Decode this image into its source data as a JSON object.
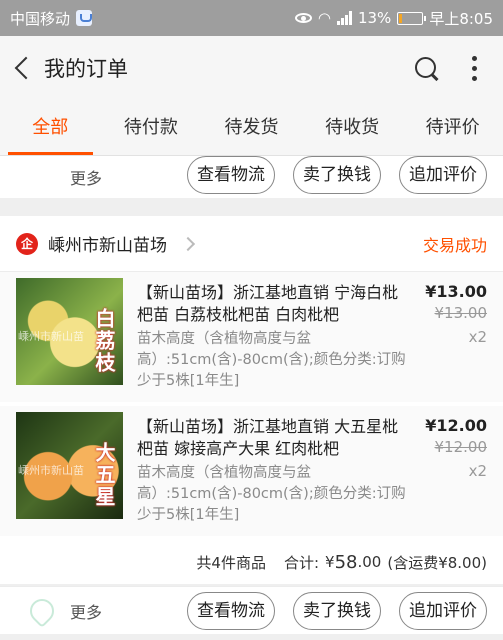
{
  "status_bar": {
    "carrier": "中国移动",
    "network": "2G",
    "battery": "13%",
    "time": "早上8:05"
  },
  "nav": {
    "title": "我的订单"
  },
  "tabs": [
    {
      "label": "全部",
      "active": true
    },
    {
      "label": "待付款",
      "active": false
    },
    {
      "label": "待发货",
      "active": false
    },
    {
      "label": "待收货",
      "active": false
    },
    {
      "label": "待评价",
      "active": false
    }
  ],
  "order_actions": {
    "more": "更多",
    "logistics": "查看物流",
    "sell": "卖了换钱",
    "review": "追加评价"
  },
  "order": {
    "shop_name": "嵊州市新山苗场",
    "status": "交易成功",
    "items": [
      {
        "title": "【新山苗场】浙江基地直销 宁海白枇杷苗 白荔枝枇杷苗 白肉枇杷",
        "sku": "苗木高度（含植物高度与盆高）:51cm(含)-80cm(含);颜色分类:订购少于5株[1年生]",
        "price": "¥13.00",
        "original_price": "¥13.00",
        "quantity": "x2",
        "image_label": "白荔枝",
        "image_watermark": "嵊州市新山苗"
      },
      {
        "title": "【新山苗场】浙江基地直销 大五星枇杷苗 嫁接高产大果 红肉枇杷",
        "sku": "苗木高度（含植物高度与盆高）:51cm(含)-80cm(含);颜色分类:订购少于5株[1年生]",
        "price": "¥12.00",
        "original_price": "¥12.00",
        "quantity": "x2",
        "image_label": "大五星",
        "image_watermark": "嵊州市新山苗"
      }
    ],
    "summary": {
      "count_text": "共4件商品",
      "total_label": "合计:",
      "total_currency": "¥",
      "total_int": "58",
      "total_dec": ".00",
      "shipping": "(含运费¥8.00)"
    }
  }
}
